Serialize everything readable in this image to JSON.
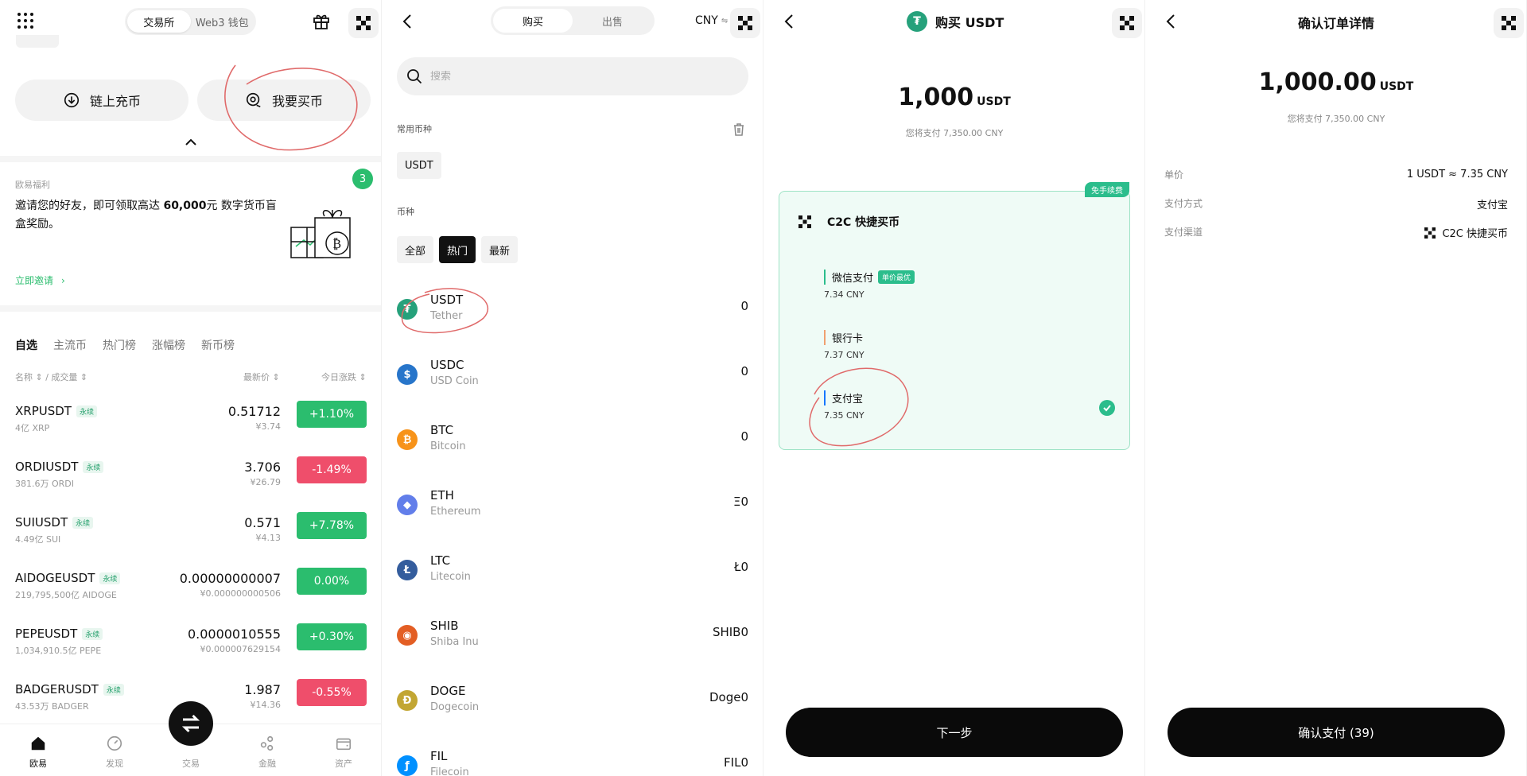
{
  "p1": {
    "seg": [
      "交易所",
      "Web3 钱包"
    ],
    "deposit_label": "链上充币",
    "buy_label": "我要买币",
    "welfare": {
      "title": "欧易福利",
      "badge": "3",
      "text_a": "邀请您的好友，即可领取高达 ",
      "text_b": "60,000",
      "text_c": "元 数字货币盲盒奖励。",
      "link": "立即邀请"
    },
    "tabs": [
      "自选",
      "主流币",
      "热门榜",
      "涨幅榜",
      "新币榜"
    ],
    "colheads": {
      "name": "名称 ⇕ / 成交量 ⇕",
      "price": "最新价 ⇕",
      "change": "今日涨跌 ⇕"
    },
    "rows": [
      {
        "sym": "XRPUSDT",
        "tag": "永续",
        "vol": "4亿 XRP",
        "price": "0.51712",
        "cny": "¥3.74",
        "chg": "+1.10%",
        "dir": "up"
      },
      {
        "sym": "ORDIUSDT",
        "tag": "永续",
        "vol": "381.6万 ORDI",
        "price": "3.706",
        "cny": "¥26.79",
        "chg": "-1.49%",
        "dir": "down"
      },
      {
        "sym": "SUIUSDT",
        "tag": "永续",
        "vol": "4.49亿 SUI",
        "price": "0.571",
        "cny": "¥4.13",
        "chg": "+7.78%",
        "dir": "up"
      },
      {
        "sym": "AIDOGEUSDT",
        "tag": "永续",
        "vol": "219,795,500亿 AIDOGE",
        "price": "0.00000000007",
        "cny": "¥0.000000000506",
        "chg": "0.00%",
        "dir": "up"
      },
      {
        "sym": "PEPEUSDT",
        "tag": "永续",
        "vol": "1,034,910.5亿 PEPE",
        "price": "0.0000010555",
        "cny": "¥0.000007629154",
        "chg": "+0.30%",
        "dir": "up"
      },
      {
        "sym": "BADGERUSDT",
        "tag": "永续",
        "vol": "43.53万 BADGER",
        "price": "1.987",
        "cny": "¥14.36",
        "chg": "-0.55%",
        "dir": "down"
      }
    ],
    "nav": [
      "欧易",
      "发现",
      "交易",
      "金融",
      "资产"
    ]
  },
  "p2": {
    "tabs": [
      "购买",
      "出售"
    ],
    "currency": "CNY",
    "search_placeholder": "搜索",
    "common_title": "常用币种",
    "common_chip": "USDT",
    "coin_title": "币种",
    "filters": [
      "全部",
      "热门",
      "最新"
    ],
    "coins": [
      {
        "sym": "USDT",
        "name": "Tether",
        "bal": "0",
        "color": "#26a17b",
        "glyph": "₮"
      },
      {
        "sym": "USDC",
        "name": "USD Coin",
        "bal": "0",
        "color": "#2775ca",
        "glyph": "$"
      },
      {
        "sym": "BTC",
        "name": "Bitcoin",
        "bal": "0",
        "color": "#f7931a",
        "glyph": "₿"
      },
      {
        "sym": "ETH",
        "name": "Ethereum",
        "bal": "Ξ0",
        "color": "#627eea",
        "glyph": "◆"
      },
      {
        "sym": "LTC",
        "name": "Litecoin",
        "bal": "Ł0",
        "color": "#345d9d",
        "glyph": "Ł"
      },
      {
        "sym": "SHIB",
        "name": "Shiba Inu",
        "bal": "SHIB0",
        "color": "#e35e24",
        "glyph": "◉"
      },
      {
        "sym": "DOGE",
        "name": "Dogecoin",
        "bal": "Doge0",
        "color": "#c2a633",
        "glyph": "Ð"
      },
      {
        "sym": "FIL",
        "name": "Filecoin",
        "bal": "FIL0",
        "color": "#0090ff",
        "glyph": "ƒ"
      }
    ]
  },
  "p3": {
    "title": "购买 USDT",
    "amount": "1,000",
    "unit": "USDT",
    "pay_note": "您将支付 7,350.00 CNY",
    "card_title": "C2C 快捷买币",
    "free_tag": "免手续费",
    "methods": [
      {
        "label": "微信支付",
        "rate": "7.34 CNY",
        "badge": "单价最优",
        "bar": "#2bbd8c"
      },
      {
        "label": "银行卡",
        "rate": "7.37 CNY",
        "badge": "",
        "bar": "#f0a070"
      },
      {
        "label": "支付宝",
        "rate": "7.35 CNY",
        "badge": "",
        "bar": "#1677ff"
      }
    ],
    "next": "下一步"
  },
  "p4": {
    "title": "确认订单详情",
    "amount": "1,000.00",
    "unit": "USDT",
    "pay_note": "您将支付 7,350.00 CNY",
    "rows": [
      {
        "k": "单价",
        "v": "1 USDT ≈ 7.35 CNY"
      },
      {
        "k": "支付方式",
        "v": "支付宝"
      },
      {
        "k": "支付渠道",
        "v": "C2C 快捷买币"
      }
    ],
    "confirm": "确认支付 (39)"
  },
  "colors": {
    "accent_green": "#2bbd6e",
    "accent_red": "#ef4e6b",
    "teal": "#2bbd8c",
    "annotation": "#e06a6a"
  }
}
